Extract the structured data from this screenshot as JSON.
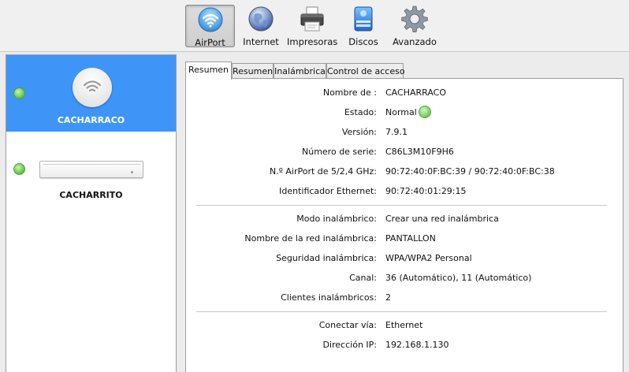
{
  "toolbar": {
    "items": [
      {
        "label": "AirPort",
        "icon": "airport-wifi-icon",
        "active": true
      },
      {
        "label": "Internet",
        "icon": "globe-icon",
        "active": false
      },
      {
        "label": "Impresoras",
        "icon": "printer-icon",
        "active": false
      },
      {
        "label": "Discos",
        "icon": "disk-icon",
        "active": false
      },
      {
        "label": "Avanzado",
        "icon": "gear-icon",
        "active": false
      }
    ]
  },
  "sidebar": {
    "devices": [
      {
        "name": "CACHARRACO",
        "status_color": "#69c94f",
        "selected": true,
        "icon": "airport-base-station-icon"
      },
      {
        "name": "CACHARRITO",
        "status_color": "#69c94f",
        "selected": false,
        "icon": "airport-express-icon"
      }
    ]
  },
  "tabs": [
    "Resumen",
    "Resumen",
    "Inalámbrica",
    "Control de acceso"
  ],
  "summary": {
    "group1": [
      {
        "label": "Nombre de :",
        "value": "CACHARRACO"
      },
      {
        "label": "Estado:",
        "value": "Normal"
      },
      {
        "label": "Versión:",
        "value": "7.9.1"
      },
      {
        "label": "Número de serie:",
        "value": "C86L3M10F9H6"
      },
      {
        "label": "N.º AirPort de 5/2,4 GHz:",
        "value": "90:72:40:0F:BC:39 / 90:72:40:0F:BC:38"
      },
      {
        "label": "Identificador Ethernet:",
        "value": "90:72:40:01:29:15"
      }
    ],
    "group2": [
      {
        "label": "Modo inalámbrico:",
        "value": "Crear una red inalámbrica"
      },
      {
        "label": "Nombre de la red inalámbrica:",
        "value": "PANTALLON"
      },
      {
        "label": "Seguridad inalámbrica:",
        "value": "WPA/WPA2 Personal"
      },
      {
        "label": "Canal:",
        "value": "36 (Automático), 11 (Automático)"
      },
      {
        "label": "Clientes inalámbricos:",
        "value": "2"
      }
    ],
    "group3": [
      {
        "label": "Conectar vía:",
        "value": "Ethernet"
      },
      {
        "label": "Dirección IP:",
        "value": "192.168.1.130"
      }
    ],
    "status_color": "#7fd066"
  },
  "colors": {
    "selection": "#3e95f7",
    "status_green": "#69c94f"
  }
}
